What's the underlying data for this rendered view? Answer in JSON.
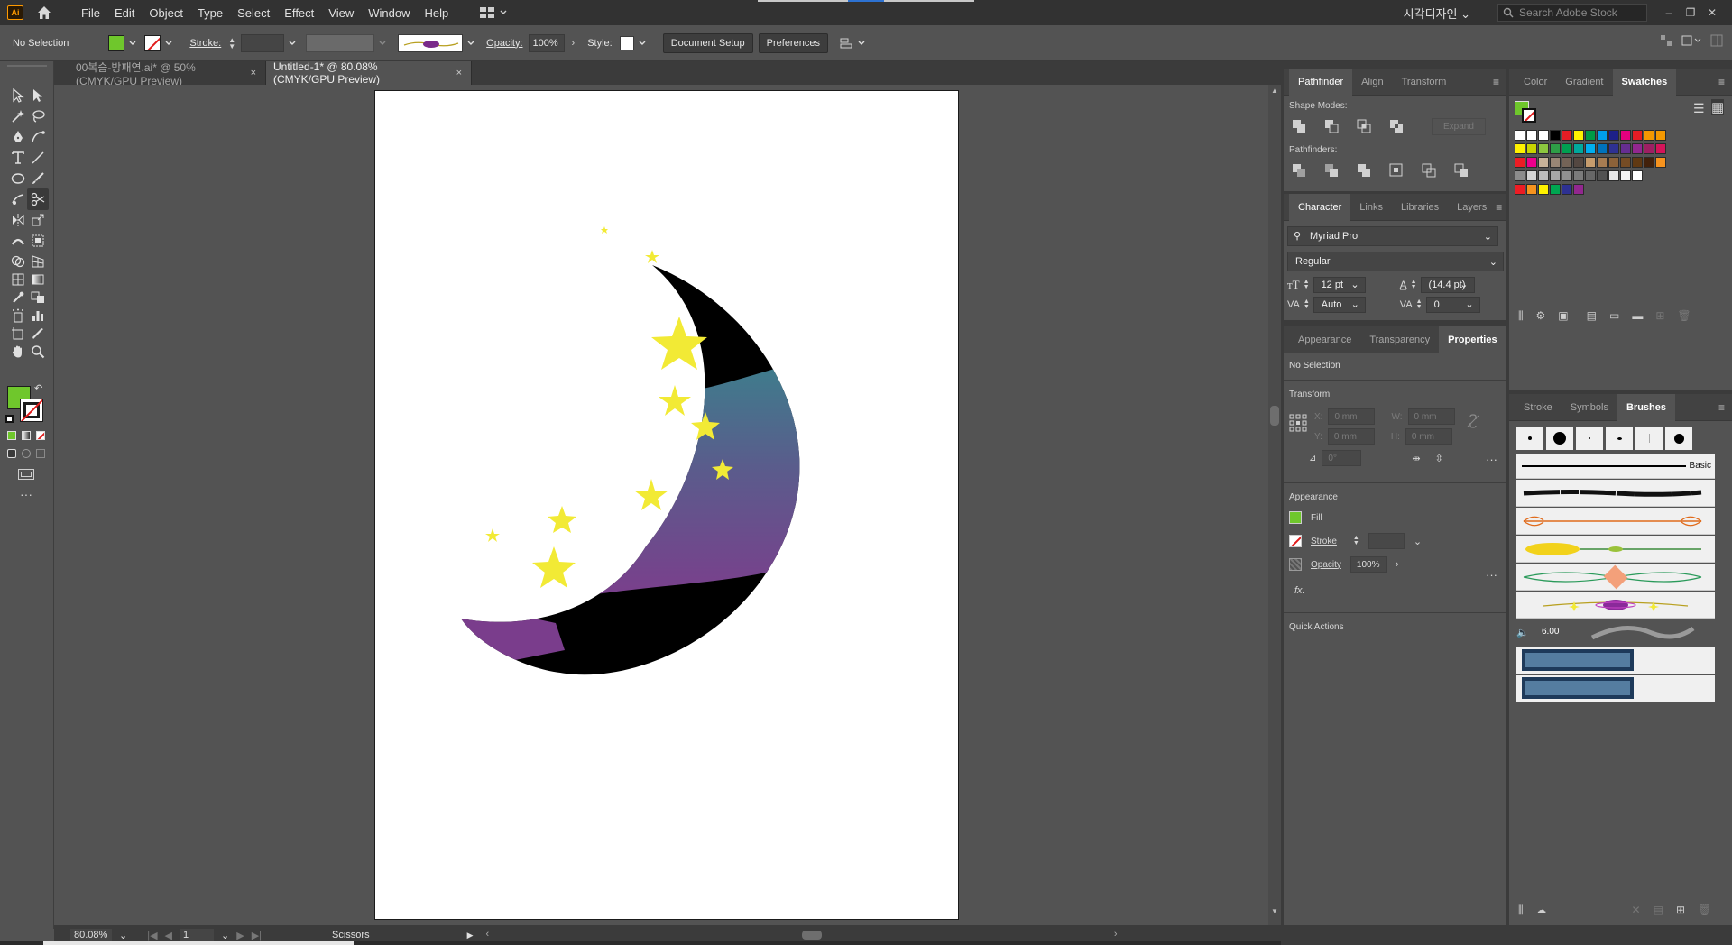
{
  "app": {
    "logo_text": "Ai",
    "workspace_name": "시각디자인",
    "stock_search_placeholder": "Search Adobe Stock"
  },
  "menu": [
    "File",
    "Edit",
    "Object",
    "Type",
    "Select",
    "Effect",
    "View",
    "Window",
    "Help"
  ],
  "control_bar": {
    "selection": "No Selection",
    "stroke_label": "Stroke:",
    "opacity_label": "Opacity:",
    "opacity_value": "100%",
    "style_label": "Style:",
    "document_setup": "Document Setup",
    "preferences": "Preferences",
    "fill_color": "#6fc72c"
  },
  "tabs": [
    {
      "label": "00복습-방패연.ai* @ 50% (CMYK/GPU Preview)",
      "close": "×"
    },
    {
      "label": "Untitled-1* @ 80.08% (CMYK/GPU Preview)",
      "close": "×"
    }
  ],
  "status": {
    "zoom": "80.08%",
    "page": "1",
    "tool": "Scissors"
  },
  "pathfinder_panel": {
    "tabs": [
      "Pathfinder",
      "Align",
      "Transform"
    ],
    "shape_modes_label": "Shape Modes:",
    "expand_label": "Expand",
    "pathfinders_label": "Pathfinders:"
  },
  "character_panel": {
    "tabs": [
      "Character",
      "Links",
      "Libraries",
      "Layers"
    ],
    "font": "Myriad Pro",
    "style": "Regular",
    "font_size": "12 pt",
    "leading": "(14.4 pt)",
    "kerning": "Auto",
    "tracking": "0"
  },
  "properties_panel": {
    "tabs": [
      "Appearance",
      "Transparency",
      "Properties"
    ],
    "no_selection": "No Selection",
    "transform_label": "Transform",
    "x_label": "X:",
    "y_label": "Y:",
    "w_label": "W:",
    "h_label": "H:",
    "x_value": "0 mm",
    "y_value": "0 mm",
    "w_value": "0 mm",
    "h_value": "0 mm",
    "angle_value": "0°",
    "appearance_label": "Appearance",
    "fill_label": "Fill",
    "stroke_label": "Stroke",
    "opacity_label": "Opacity",
    "opacity_value": "100%",
    "fx_label": "fx.",
    "quick_actions_label": "Quick Actions"
  },
  "swatches_panel": {
    "tabs": [
      "Color",
      "Gradient",
      "Swatches"
    ]
  },
  "brushes_panel": {
    "tabs": [
      "Stroke",
      "Symbols",
      "Brushes"
    ],
    "basic_label": "Basic",
    "size_label": "6.00"
  },
  "colors": {
    "moon_top": "#000000",
    "moon_band_top": "#3d7e8c",
    "moon_band_bottom": "#7a3f8c",
    "star": "#f2ea35",
    "purple_tail": "#7a3d8c"
  },
  "swatch_rows": [
    [
      "#ffffff",
      "#ffffff",
      "#ffffff",
      "#000000",
      "#e31d25",
      "#fff200",
      "#009a44",
      "#00a0e9",
      "#1d2088",
      "#e5007f",
      "#e31d25",
      "#f39800",
      "#f39800"
    ],
    [
      "#fff200",
      "#c9d400",
      "#8cc63f",
      "#2e9e47",
      "#00a051",
      "#00a99d",
      "#00aeef",
      "#0072bc",
      "#2e3192",
      "#662d91",
      "#92278f",
      "#9e1f63",
      "#d4145a"
    ],
    [
      "#ed1c24",
      "#ec008c",
      "#c7b299",
      "#998675",
      "#736357",
      "#534741",
      "#c69c6d",
      "#a67c52",
      "#8c6239",
      "#754c24",
      "#603913",
      "#42210b",
      "#f7931e"
    ],
    [
      "#8c8c8c",
      "#d4d4d4",
      "#bcbcbc",
      "#a7a7a7",
      "#909090",
      "#7b7b7b",
      "#676767",
      "#525252",
      "#e6e6e6",
      "#f2f2f2",
      "#ffffff"
    ],
    [
      "#ed1c24",
      "#f7931e",
      "#fff200",
      "#00a651",
      "#2e3192",
      "#92278f"
    ]
  ]
}
